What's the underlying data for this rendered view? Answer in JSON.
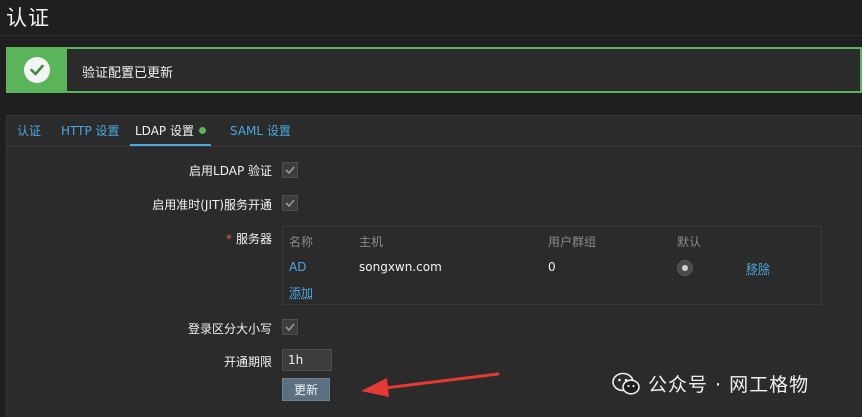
{
  "page": {
    "title": "认证"
  },
  "alert": {
    "message": "验证配置已更新",
    "status_color": "#59b45a"
  },
  "tabs": [
    {
      "label": "认证"
    },
    {
      "label": "HTTP 设置"
    },
    {
      "label": "LDAP 设置",
      "active": true
    },
    {
      "label": "SAML 设置"
    }
  ],
  "form": {
    "enable_ldap_label": "启用LDAP 验证",
    "enable_ldap_checked": true,
    "enable_jit_label": "启用准时(JIT)服务开通",
    "enable_jit_checked": true,
    "servers_label": "服务器",
    "servers_required_mark": "*",
    "servers": {
      "headers": [
        "名称",
        "主机",
        "用户群组",
        "默认"
      ],
      "rows": [
        {
          "name": "AD",
          "host": "songxwn.com",
          "user_groups": "0",
          "default_selected": true,
          "remove_label": "移除"
        }
      ],
      "add_label": "添加"
    },
    "case_sensitive_label": "登录区分大小写",
    "case_sensitive_checked": true,
    "provision_period_label": "开通期限",
    "provision_period_value": "1h",
    "update_button": "更新"
  },
  "watermark": {
    "text": "公众号 · 网工格物"
  },
  "colors": {
    "accent": "#4aa8e0",
    "success": "#59b45a",
    "arrow": "#e53935"
  }
}
